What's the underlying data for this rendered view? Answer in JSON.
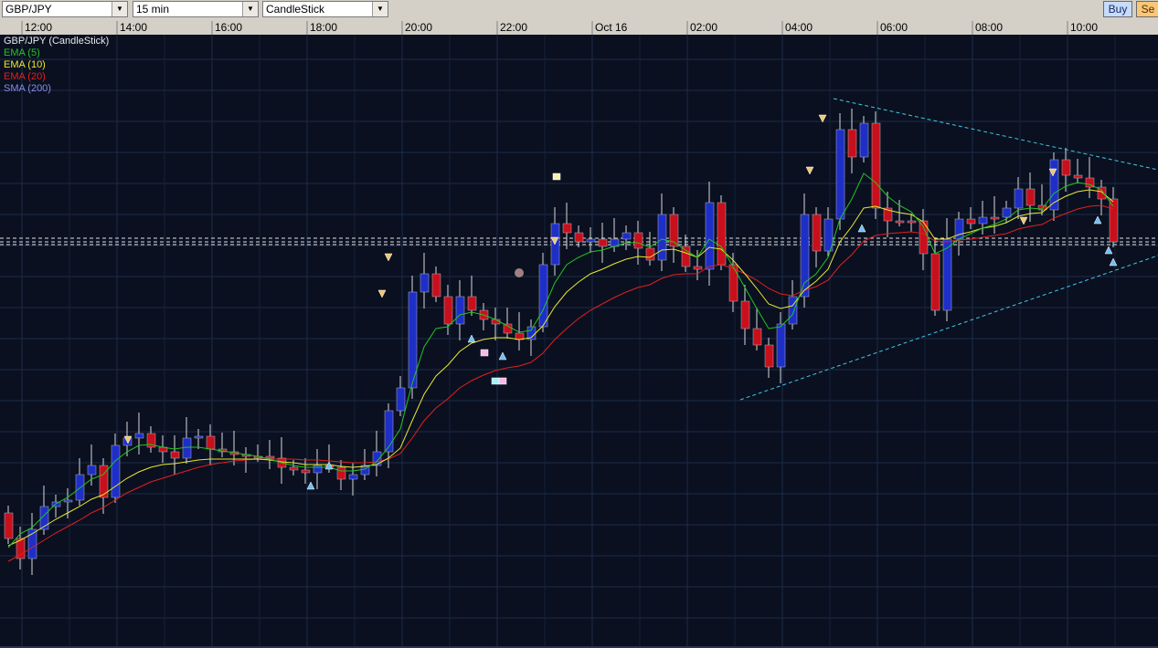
{
  "toolbar": {
    "symbol": "GBP/JPY",
    "interval": "15 min",
    "chart_type": "CandleStick",
    "buy_label": "Buy",
    "sell_label": "Se",
    "dropdown_icon": "chevron-down-icon"
  },
  "colors": {
    "background": "#0a1020",
    "grid": "#1c2c48",
    "bull": "#1e2fc8",
    "bear": "#c8101c",
    "wick": "#d8d8d8",
    "ema5": "#22c422",
    "ema10": "#e8e830",
    "ema20": "#e02020",
    "sma200": "#8a8ae8",
    "trendline": "#40c8e8",
    "buy_button": "#c8dcf8",
    "sell_button": "#f8c878"
  },
  "chart_data": {
    "type": "candlestick",
    "title": "GBP/JPY (CandleStick)",
    "x_ticks": [
      "12:00",
      "14:00",
      "16:00",
      "18:00",
      "20:00",
      "22:00",
      "Oct 16",
      "02:00",
      "04:00",
      "06:00",
      "08:00",
      "10:00"
    ],
    "legend": [
      {
        "label": "EMA (5)",
        "color": "#22c422"
      },
      {
        "label": "EMA (10)",
        "color": "#e8e830"
      },
      {
        "label": "EMA (20)",
        "color": "#e02020"
      },
      {
        "label": "SMA (200)",
        "color": "#8a8ae8"
      }
    ],
    "legend_position": "top-left",
    "grid": true,
    "closes": [
      590,
      612,
      580,
      555,
      550,
      548,
      520,
      510,
      545,
      488,
      480,
      475,
      490,
      495,
      502,
      480,
      478,
      492,
      495,
      498,
      500,
      500,
      502,
      512,
      515,
      518,
      510,
      512,
      525,
      520,
      510,
      495,
      450,
      425,
      320,
      300,
      325,
      355,
      325,
      340,
      350,
      355,
      365,
      372,
      358,
      290,
      245,
      255,
      265,
      262,
      270,
      262,
      255,
      272,
      285,
      235,
      270,
      292,
      295,
      222,
      290,
      330,
      360,
      378,
      402,
      355,
      325,
      235,
      275,
      240,
      142,
      172,
      135,
      228,
      242,
      242,
      242,
      278,
      340,
      262,
      240,
      245,
      238,
      238,
      228,
      207,
      225,
      230,
      175,
      192,
      195,
      205,
      218,
      265
    ],
    "opens": [
      562,
      590,
      612,
      580,
      555,
      550,
      548,
      520,
      510,
      545,
      488,
      480,
      475,
      490,
      495,
      502,
      480,
      478,
      492,
      495,
      498,
      500,
      500,
      502,
      512,
      515,
      518,
      510,
      512,
      525,
      520,
      510,
      495,
      450,
      425,
      320,
      300,
      325,
      355,
      325,
      340,
      350,
      355,
      365,
      372,
      358,
      290,
      245,
      255,
      265,
      262,
      270,
      262,
      255,
      272,
      285,
      235,
      270,
      292,
      295,
      222,
      290,
      330,
      360,
      378,
      402,
      355,
      325,
      235,
      275,
      240,
      142,
      172,
      135,
      228,
      242,
      242,
      242,
      278,
      340,
      262,
      240,
      245,
      238,
      238,
      228,
      207,
      225,
      230,
      175,
      192,
      195,
      205,
      218
    ],
    "ema5": [
      600,
      585,
      578,
      565,
      552,
      545,
      535,
      525,
      520,
      505,
      495,
      488,
      487,
      490,
      492,
      490,
      490,
      492,
      494,
      496,
      498,
      500,
      503,
      507,
      510,
      512,
      512,
      512,
      516,
      516,
      514,
      506,
      490,
      470,
      420,
      380,
      360,
      358,
      345,
      342,
      345,
      350,
      357,
      364,
      362,
      340,
      310,
      290,
      282,
      276,
      274,
      270,
      266,
      266,
      271,
      262,
      265,
      274,
      282,
      262,
      270,
      292,
      315,
      338,
      360,
      358,
      345,
      310,
      300,
      282,
      240,
      218,
      190,
      200,
      215,
      225,
      232,
      248,
      278,
      272,
      262,
      256,
      250,
      246,
      240,
      230,
      228,
      229,
      212,
      204,
      200,
      202,
      208,
      226
    ],
    "ema10": [
      598,
      592,
      585,
      577,
      569,
      562,
      555,
      547,
      542,
      533,
      524,
      517,
      512,
      509,
      508,
      506,
      504,
      503,
      503,
      503,
      503,
      503,
      504,
      506,
      507,
      509,
      509,
      509,
      511,
      512,
      511,
      509,
      502,
      491,
      461,
      432,
      412,
      400,
      385,
      376,
      372,
      370,
      370,
      372,
      370,
      357,
      336,
      320,
      309,
      300,
      295,
      289,
      284,
      281,
      282,
      274,
      273,
      277,
      282,
      271,
      273,
      285,
      300,
      316,
      333,
      338,
      335,
      318,
      308,
      295,
      265,
      248,
      228,
      226,
      230,
      233,
      235,
      243,
      262,
      262,
      257,
      254,
      250,
      248,
      244,
      237,
      234,
      233,
      222,
      215,
      210,
      208,
      210,
      221
    ],
    "ema20": [
      615,
      608,
      600,
      592,
      584,
      577,
      570,
      562,
      556,
      548,
      540,
      534,
      528,
      524,
      520,
      516,
      512,
      509,
      507,
      505,
      504,
      503,
      503,
      503,
      503,
      504,
      504,
      505,
      506,
      507,
      507,
      506,
      503,
      497,
      480,
      461,
      447,
      437,
      425,
      417,
      411,
      406,
      403,
      401,
      397,
      387,
      372,
      360,
      349,
      340,
      333,
      326,
      320,
      315,
      312,
      305,
      301,
      300,
      300,
      292,
      290,
      294,
      300,
      307,
      316,
      322,
      324,
      318,
      314,
      307,
      291,
      279,
      264,
      258,
      256,
      255,
      254,
      256,
      264,
      265,
      263,
      262,
      260,
      258,
      256,
      251,
      248,
      246,
      239,
      234,
      229,
      226,
      225,
      229
    ]
  },
  "signals": [
    {
      "type": "down",
      "index": 12
    },
    {
      "type": "up",
      "index": 33
    },
    {
      "type": "down",
      "index": 39
    },
    {
      "type": "up",
      "index": 47
    },
    {
      "type": "up",
      "index": 51
    },
    {
      "type": "down",
      "index": 56
    },
    {
      "type": "down",
      "index": 82
    },
    {
      "type": "down",
      "index": 83
    },
    {
      "type": "up",
      "index": 86
    },
    {
      "type": "down",
      "index": 102
    },
    {
      "type": "down",
      "index": 104
    },
    {
      "type": "up",
      "index": 116
    },
    {
      "type": "up",
      "index": 117
    }
  ]
}
